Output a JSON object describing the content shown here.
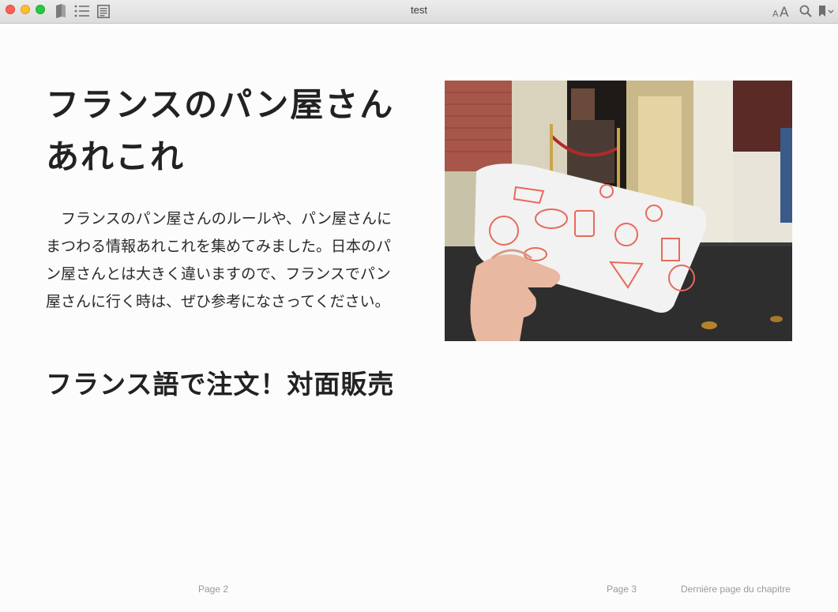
{
  "window": {
    "title": "test"
  },
  "toolbar": {
    "icons": [
      "library-icon",
      "table-of-contents-icon",
      "notes-icon",
      "font-size-icon",
      "search-icon",
      "bookmark-icon"
    ]
  },
  "content": {
    "chapter_title": "フランスのパン屋さんあれこれ",
    "intro_paragraph": "フランスのパン屋さんのルールや、パン屋さんにまつわる情報あれこれを集めてみました。日本のパン屋さんとは大きく違いますので、フランスでパン屋さんに行く時は、ぜひ参考になさってください。",
    "section_heading": "フランス語で注文！対面販売"
  },
  "footer": {
    "left_page": "Page 2",
    "right_page": "Page 3",
    "last_page_note": "Dernière page du chapitre"
  },
  "colors": {
    "close": "#ff5f57",
    "minimize": "#febc2e",
    "maximize": "#28c840",
    "bag_print": "#e86a5a"
  }
}
